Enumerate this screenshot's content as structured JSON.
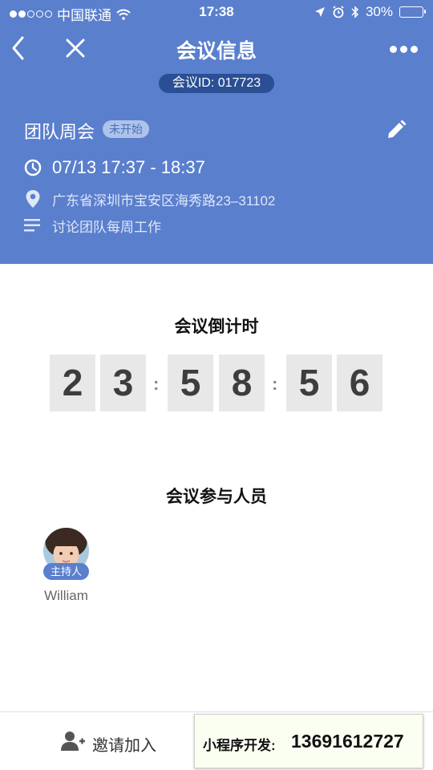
{
  "status_bar": {
    "carrier": "中国联通",
    "time": "17:38",
    "battery": "30%",
    "battery_level": 0.3,
    "signal_filled": 2,
    "signal_total": 5
  },
  "nav": {
    "title": "会议信息",
    "back_icon": "chevron-left-icon",
    "close_icon": "close-icon",
    "more_icon": "more-dots-icon"
  },
  "meeting": {
    "id_label": "会议ID: 017723",
    "title": "团队周会",
    "status": "未开始",
    "time": "07/13 17:37 - 18:37",
    "location": "广东省深圳市宝安区海秀路23–31102",
    "description": "讨论团队每周工作"
  },
  "countdown": {
    "title": "会议倒计时",
    "digits": [
      "2",
      "3",
      "5",
      "8",
      "5",
      "6"
    ],
    "separator": ":"
  },
  "participants": {
    "title": "会议参与人员",
    "list": [
      {
        "name": "William",
        "role": "主持人"
      }
    ]
  },
  "bottom": {
    "invite_label": "邀请加入",
    "promo_label": "小程序开发:",
    "promo_phone": "13691612727"
  },
  "colors": {
    "header_bg": "#5a7fcd",
    "id_pill": "#2a4f94",
    "digit_bg": "#e8e8e8",
    "battery": "#f5c518"
  }
}
